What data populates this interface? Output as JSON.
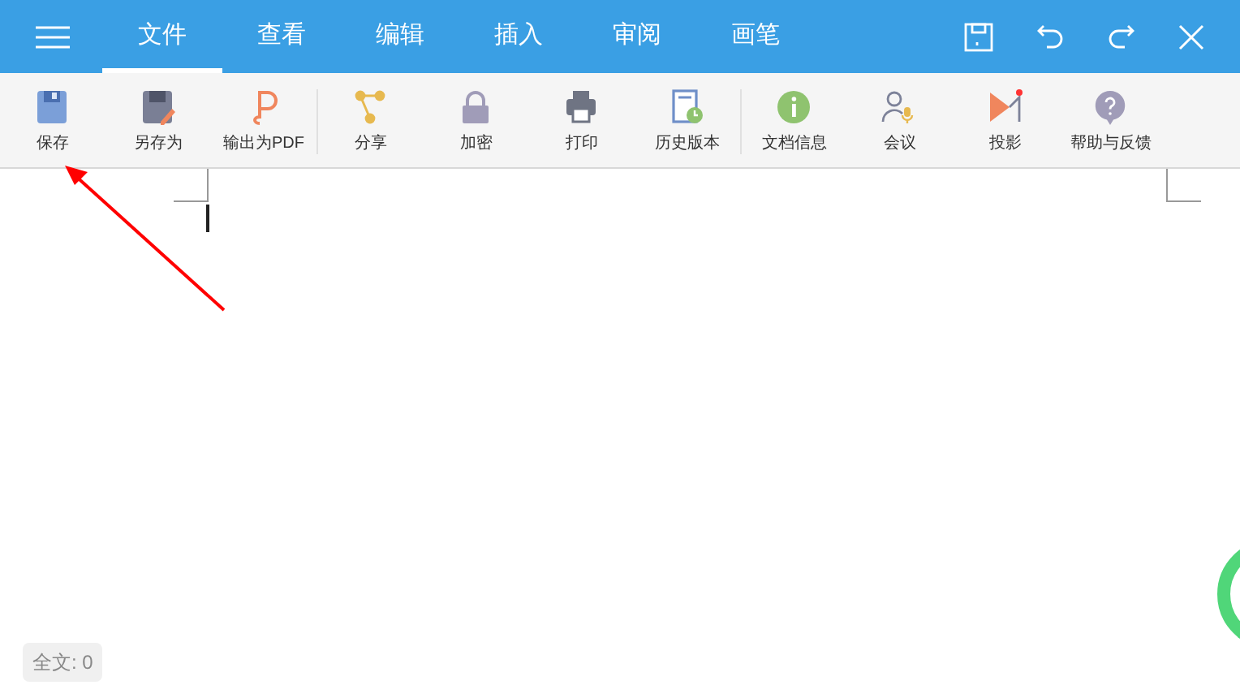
{
  "tabs": [
    {
      "label": "文件",
      "selected": true
    },
    {
      "label": "查看",
      "selected": false
    },
    {
      "label": "编辑",
      "selected": false
    },
    {
      "label": "插入",
      "selected": false
    },
    {
      "label": "审阅",
      "selected": false
    },
    {
      "label": "画笔",
      "selected": false
    }
  ],
  "toolbar": [
    {
      "kind": "save",
      "label": "保存"
    },
    {
      "kind": "save-as",
      "label": "另存为"
    },
    {
      "kind": "pdf",
      "label": "输出为PDF",
      "group_end": true
    },
    {
      "kind": "share",
      "label": "分享"
    },
    {
      "kind": "lock",
      "label": "加密"
    },
    {
      "kind": "print",
      "label": "打印"
    },
    {
      "kind": "history",
      "label": "历史版本",
      "group_end": true
    },
    {
      "kind": "info",
      "label": "文档信息"
    },
    {
      "kind": "meeting",
      "label": "会议"
    },
    {
      "kind": "project",
      "label": "投影",
      "notification": true
    },
    {
      "kind": "help",
      "label": "帮助与反馈"
    }
  ],
  "word_count": "全文: 0"
}
